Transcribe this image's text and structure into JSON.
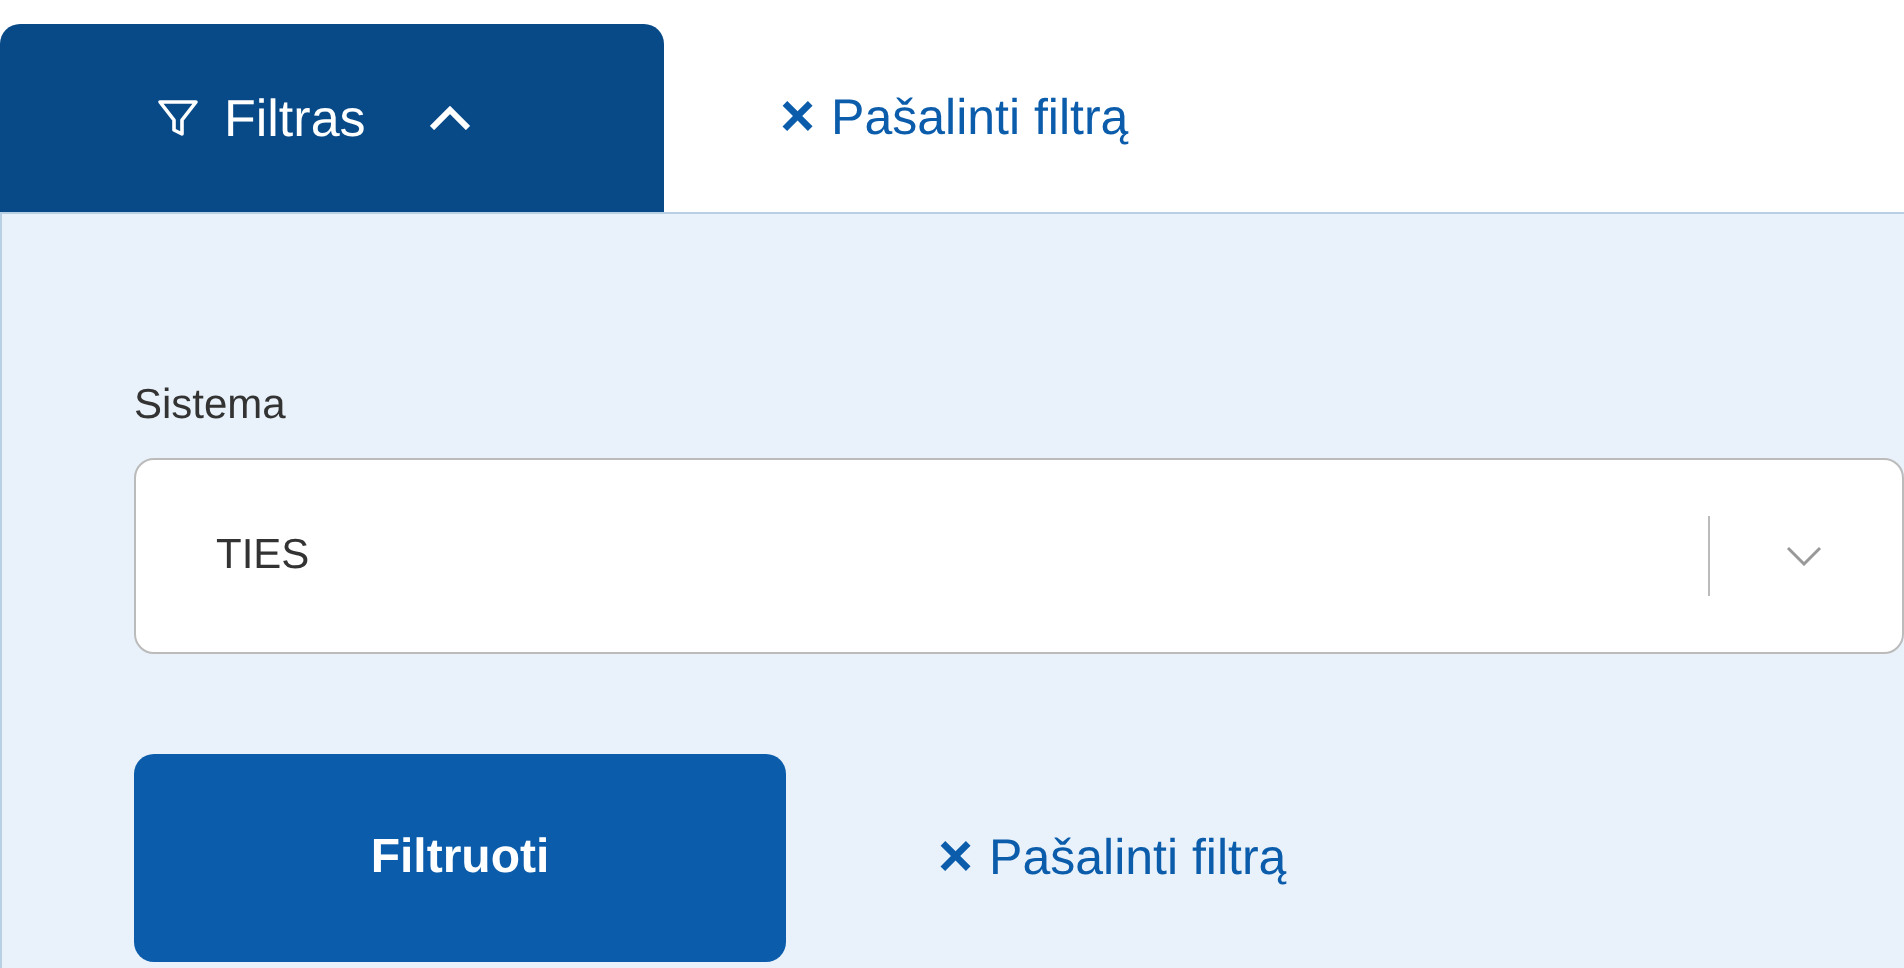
{
  "filter_tab": {
    "label": "Filtras",
    "expanded": true
  },
  "top_link": {
    "icon": "×",
    "label": "Pašalinti filtrą"
  },
  "field": {
    "label": "Sistema",
    "value": "TIES"
  },
  "primary_button": {
    "label": "Filtruoti"
  },
  "bottom_link": {
    "icon": "×",
    "label": "Pašalinti filtrą"
  }
}
